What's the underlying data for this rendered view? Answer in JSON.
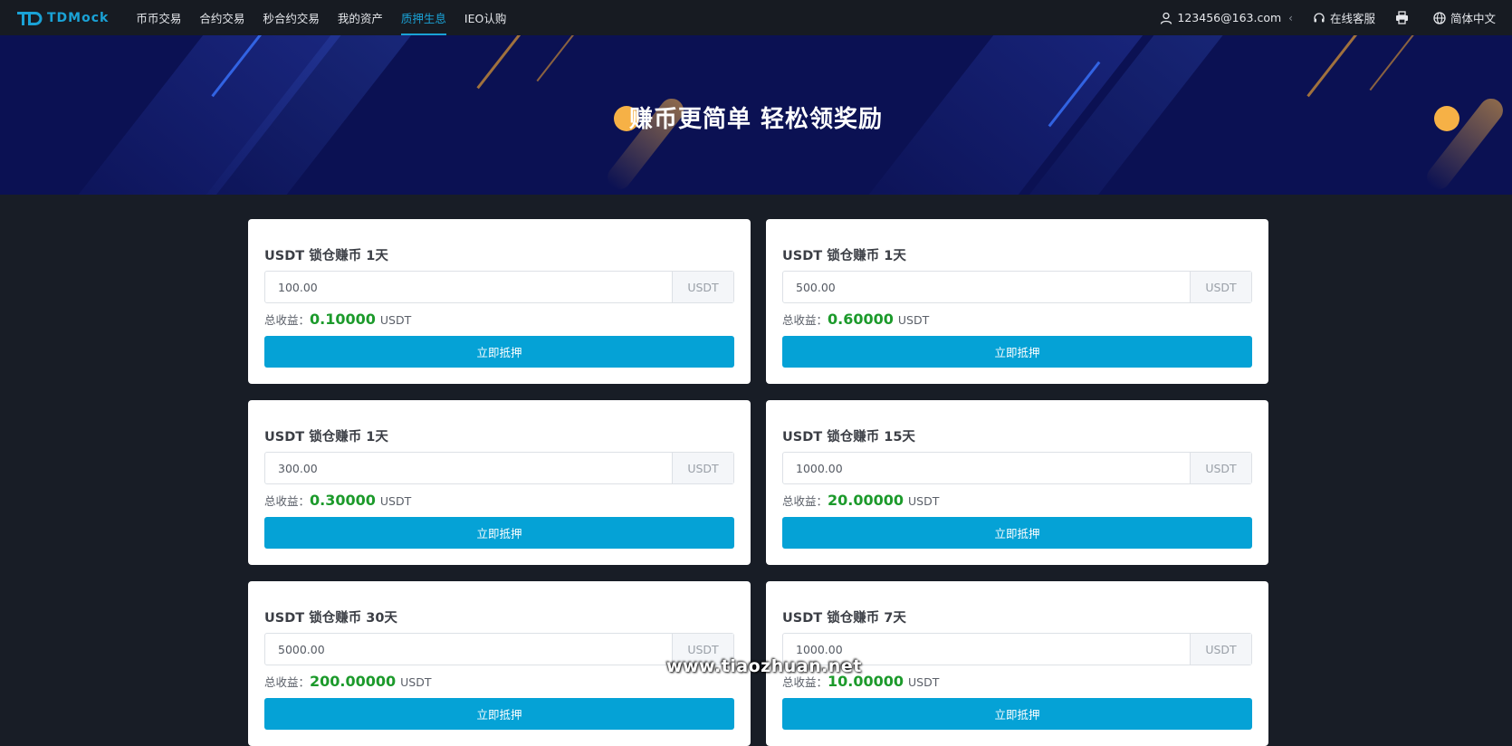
{
  "nav": {
    "logo_text": "TDMock",
    "links": [
      "币币交易",
      "合约交易",
      "秒合约交易",
      "我的资产",
      "质押生息",
      "IEO认购"
    ],
    "active_index": 4,
    "user_email": "123456@163.com",
    "support_label": "在线客服",
    "language_label": "简体中文"
  },
  "banner": {
    "title": "赚币更简单 轻松领奖励",
    "coin_color": "#f6b146",
    "background_color": "#0b1153"
  },
  "cards": [
    {
      "title": "USDT 锁仓赚币 1天",
      "amount": "100.00",
      "unit": "USDT",
      "income_label": "总收益：",
      "income_value": "0.10000",
      "income_unit": "USDT",
      "button": "立即抵押"
    },
    {
      "title": "USDT 锁仓赚币 1天",
      "amount": "500.00",
      "unit": "USDT",
      "income_label": "总收益：",
      "income_value": "0.60000",
      "income_unit": "USDT",
      "button": "立即抵押"
    },
    {
      "title": "USDT 锁仓赚币 1天",
      "amount": "300.00",
      "unit": "USDT",
      "income_label": "总收益：",
      "income_value": "0.30000",
      "income_unit": "USDT",
      "button": "立即抵押"
    },
    {
      "title": "USDT 锁仓赚币 15天",
      "amount": "1000.00",
      "unit": "USDT",
      "income_label": "总收益：",
      "income_value": "20.00000",
      "income_unit": "USDT",
      "button": "立即抵押"
    },
    {
      "title": "USDT 锁仓赚币 30天",
      "amount": "5000.00",
      "unit": "USDT",
      "income_label": "总收益：",
      "income_value": "200.00000",
      "income_unit": "USDT",
      "button": "立即抵押"
    },
    {
      "title": "USDT 锁仓赚币 7天",
      "amount": "1000.00",
      "unit": "USDT",
      "income_label": "总收益：",
      "income_value": "10.00000",
      "income_unit": "USDT",
      "button": "立即抵押"
    }
  ],
  "watermark": "www.tiaozhuan.net",
  "colors": {
    "accent": "#1aa2d6",
    "button": "#05a2d6",
    "income": "#1c9a2b",
    "page_bg": "#181d26"
  }
}
